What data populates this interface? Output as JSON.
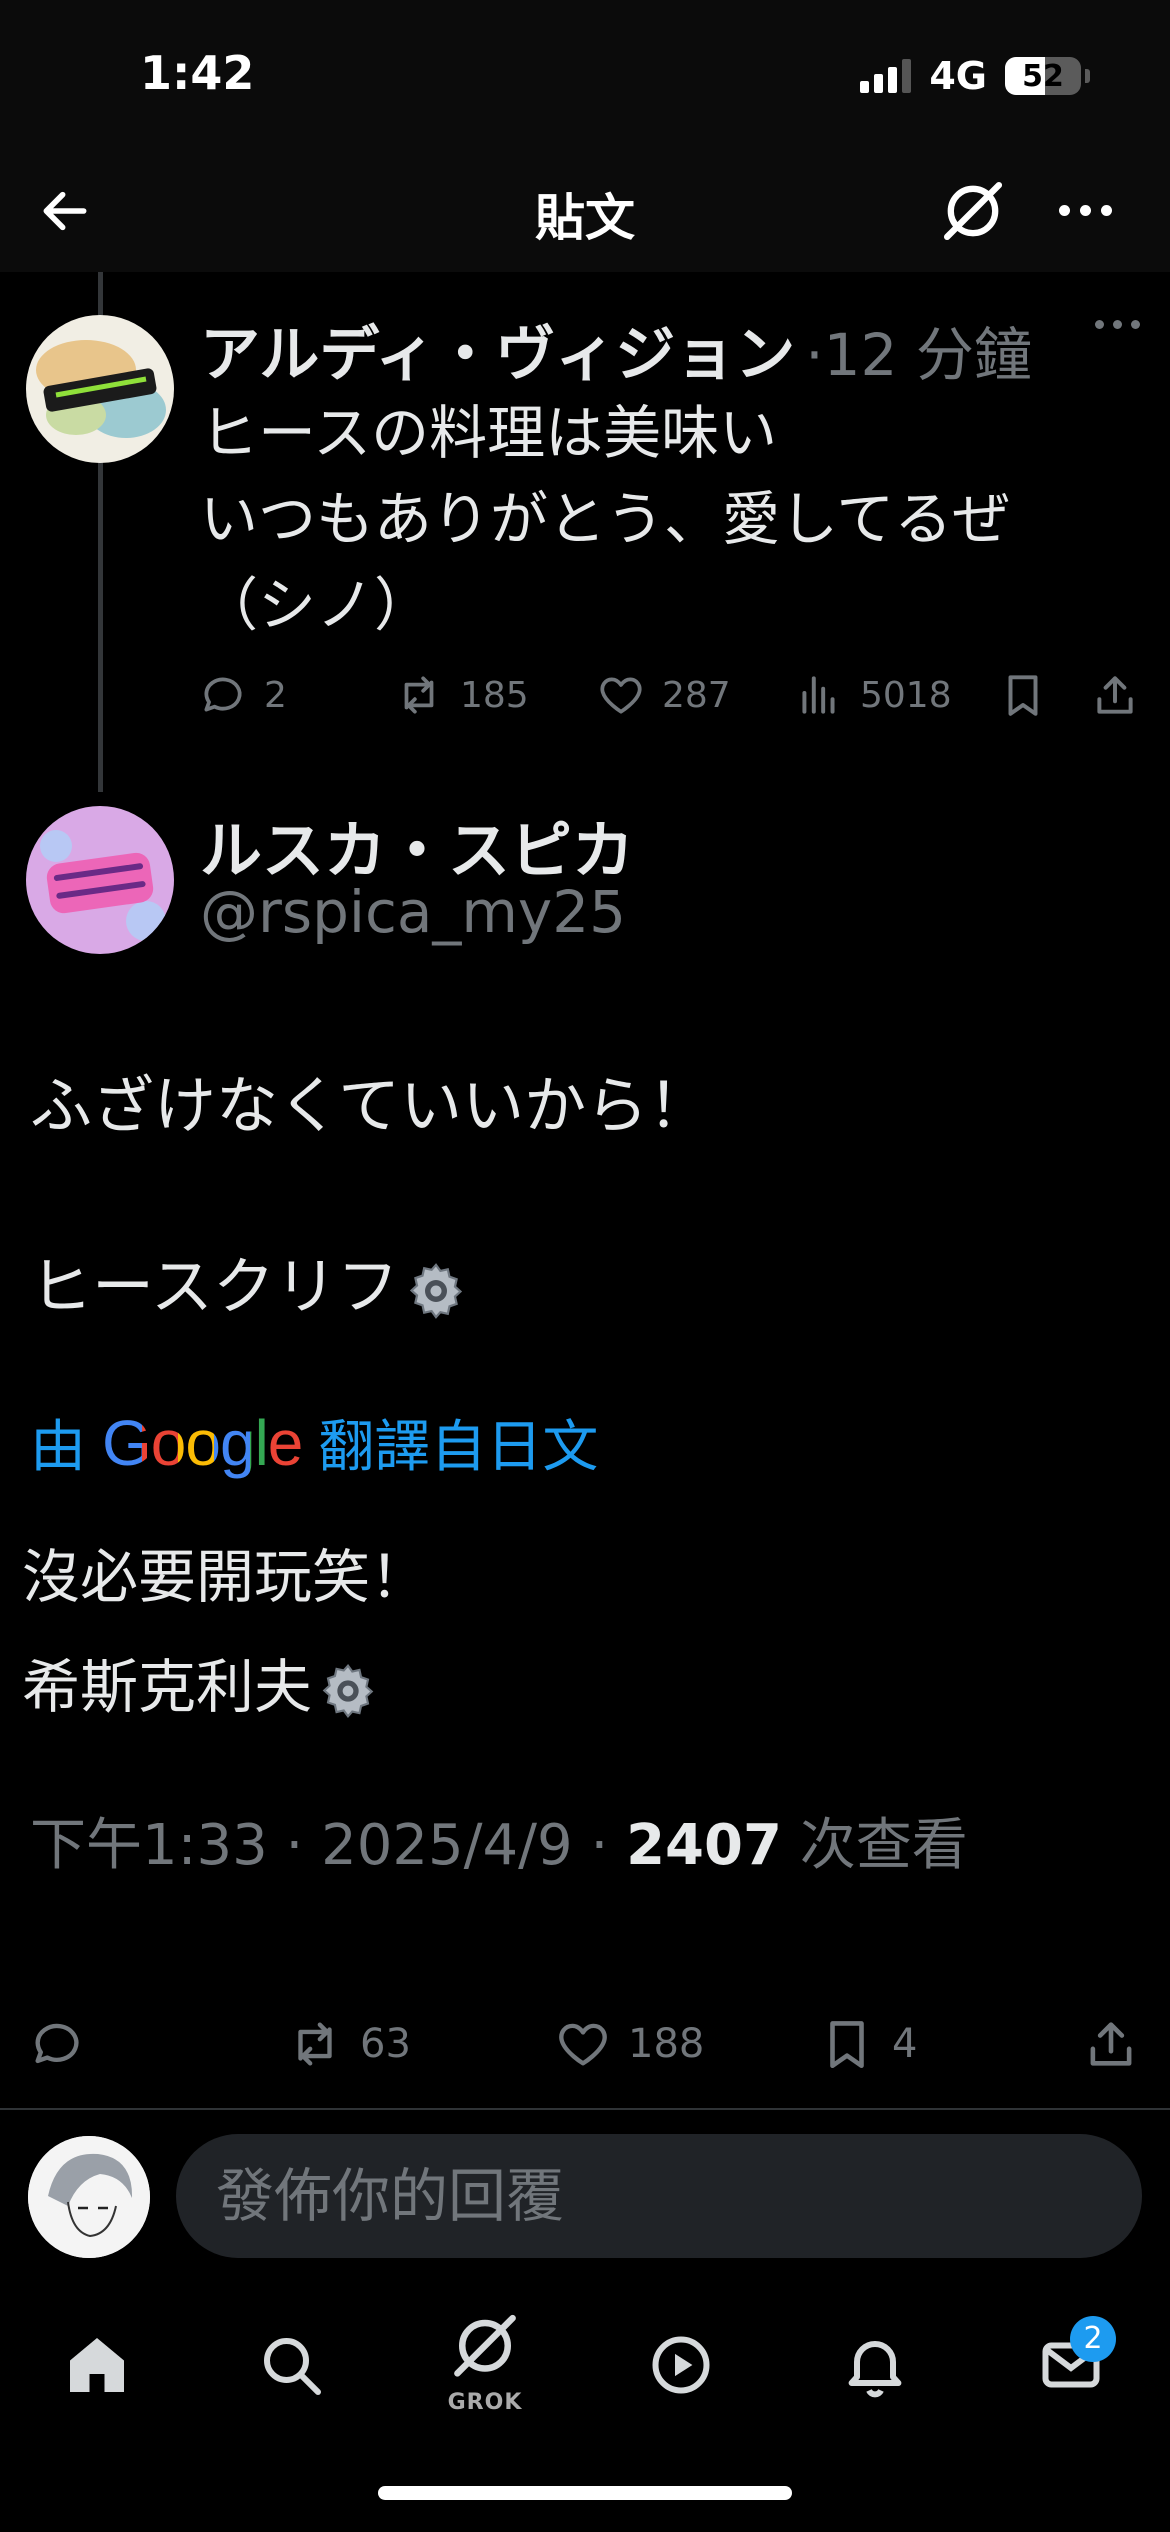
{
  "status_bar": {
    "time": "1:42",
    "network": "4G",
    "battery": "52",
    "battery_level": 0.52
  },
  "nav": {
    "title": "貼文",
    "back_icon": "arrow-left-icon",
    "grok_icon": "grok-icon",
    "more_icon": "more-horizontal-icon"
  },
  "previous_post": {
    "author_name": "アルディ・ヴィジョン",
    "time": "·12 分鐘",
    "text_lines": [
      "ヒースの料理は美味い",
      "いつもありがとう、愛してるぜ",
      "（シノ）"
    ],
    "replies": "2",
    "reposts": "185",
    "likes": "287",
    "views": "5018"
  },
  "main_post": {
    "author_name": "ルスカ・スピカ",
    "handle": "@rspica_my25",
    "line1": "ふざけなくていいから！",
    "line2": "ヒースクリフ",
    "translation": {
      "prefix": "由",
      "brand": "Google",
      "suffix": "翻譯自日文",
      "line1": "沒必要開玩笑！",
      "line2": "希斯克利夫"
    },
    "timestamp": "下午1:33 · 2025/4/9 · ",
    "views_count": "2407",
    "views_label": " 次查看",
    "reposts": "63",
    "likes": "188",
    "bookmarks": "4"
  },
  "reply": {
    "placeholder": "發佈你的回覆"
  },
  "tabbar": {
    "grok_label": "GROK",
    "messages_badge": "2"
  },
  "colors": {
    "accent": "#1d9bf0",
    "secondary_text": "#71767b",
    "primary_text": "#e7e9ea",
    "background": "#000000"
  }
}
